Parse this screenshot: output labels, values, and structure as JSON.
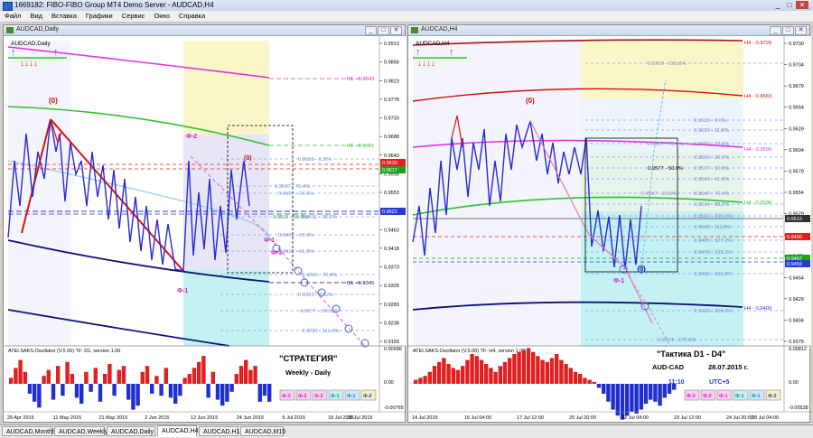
{
  "app": {
    "title": "1669182: FIBO-FIBO Group MT4 Demo Server - AUDCAD,H4",
    "window_controls": [
      "_",
      "□",
      "✕"
    ]
  },
  "menu": [
    "Файл",
    "Вид",
    "Вставка",
    "Графики",
    "Сервис",
    "Окно",
    "Справка"
  ],
  "left_chart": {
    "window_title": "AUDCAD,Daily",
    "symbol_label": "AUDCAD,Daily",
    "price_scale": [
      "0.9913",
      "0.9868",
      "0.9823",
      "0.9778",
      "0.9733",
      "0.9688",
      "0.9643",
      "0.9598",
      "0.9553",
      "0.9508",
      "0.9463",
      "0.9418",
      "0.9373",
      "0.9328",
      "0.9283",
      "0.9238",
      "0.9193"
    ],
    "price_tags": [
      "0.9633",
      "0.9617",
      "0.9521"
    ],
    "level_labels": [
      "D1 - 0.9849",
      "D1 - 0.9681",
      "D1 - 0.9345",
      "0.9656 - 0.0%",
      "0.9597 - 76.4%",
      "0.9567 - 23.6%",
      "0.9511 - 50.0%",
      "0.9511 - 38.2%",
      "0.9466 - 50.0%",
      "0.9422 - 61.8%",
      "0.9366 - 76.4%",
      "0.9322 - 88.2%",
      "0.9277 - 100.0%",
      "0.9232 - 111.8%"
    ],
    "wave_labels": [
      "(0)",
      "Ф-2",
      "(0)",
      "Ф-1",
      "Ф-3",
      "Ф-1"
    ],
    "oscillator_title": "ATEI.SAKS.Oscillator (V.5.00) TF: D1, version 1.00",
    "oscillator_scale": [
      "0.00696",
      "0.00",
      "-0.00765"
    ],
    "overlay_title": "\"СТРАТЕГИЯ\"",
    "overlay_subtitle": "Weekly - Daily",
    "fib_buttons": [
      "Ф-3",
      "Ф-2",
      "Ф-2",
      "Ф-1",
      "Ф-1",
      "Ф-2"
    ],
    "dates": [
      "29 Apr 2015",
      "11 May 2015",
      "21 May 2015",
      "2 Jun 2015",
      "12 Jun 2015",
      "24 Jun 2015",
      "6 Jul 2015",
      "16 Jul 2015",
      "28 Jul 2015"
    ]
  },
  "right_chart": {
    "window_title": "AUDCAD,H4",
    "symbol_label": "AUDCAD,H4",
    "price_scale": [
      "0.9730",
      "0.9704",
      "0.9679",
      "0.9654",
      "0.9629",
      "0.9604",
      "0.9579",
      "0.9554",
      "0.9529",
      "0.9504",
      "0.9479",
      "0.9454",
      "0.9429",
      "0.9404",
      "0.9379"
    ],
    "price_tags": [
      "0.9513",
      "0.9490",
      "0.9467",
      "0.9459"
    ],
    "level_labels": [
      "H4 - 0.9726",
      "H4 - 0.9663",
      "H4 - 0.9599",
      "H4 - 0.9536",
      "H4 - 0.9409",
      "0.9703 - 190.0%",
      "0.9633 - 0.0%",
      "0.9623 - 11.8%",
      "0.9607 - 76.4%",
      "0.9602 - 23.6%",
      "0.9590 - 38.2%",
      "0.9577 - 50.0%",
      "0.9577 - 50.0%",
      "0.9564 - 61.8%",
      "0.9547 - 23.6%",
      "0.9547 - 76.4%",
      "0.9534 - 88.2%",
      "0.9521 - 100.0%",
      "0.9508 - 111.8%",
      "0.9485 - 127.2%",
      "0.9478 - 138.2%",
      "0.9432 - 161.8%",
      "0.9409 - 200.0%",
      "0.9374 - 270.0%"
    ],
    "wave_labels": [
      "(0)",
      "Ф-1",
      "(0)"
    ],
    "oscillator_title": "ATEI.SAKS.Oscillator (V.5.00) TF: H4, version 1.00",
    "oscillator_scale": [
      "0.00812",
      "0.00",
      "-0.00538"
    ],
    "overlay_title": "\"Тактика  D1 - D4\"",
    "overlay_pair": "AUD-CAD",
    "overlay_date": "28.07.2015 г.",
    "overlay_time": "11:10",
    "overlay_tz": "UTC+5",
    "fib_buttons": [
      "Ф-3",
      "Ф-2",
      "Ф-1",
      "Ф-1",
      "Ф-1",
      "Ф-2"
    ],
    "dates": [
      "14 Jul 2015",
      "16 Jul 04:00",
      "17 Jul 12:00",
      "20 Jul 20:00",
      "22 Jul 04:00",
      "23 Jul 12:00",
      "24 Jul 20:00",
      "28 Jul 04:00"
    ]
  },
  "tabs": [
    "AUDCAD,Monthly",
    "AUDCAD,Weekly",
    "AUDCAD,Daily",
    "AUDCAD,H4",
    "AUDCAD,H1",
    "AUDCAD,M15"
  ],
  "active_tab": "AUDCAD,H4",
  "colors": {
    "bull": "#1d2ad6",
    "bear": "#e01010",
    "magenta": "#e020e0",
    "green": "#30c030",
    "navy": "#10107a",
    "zone_yellow": "#fbf6c8",
    "zone_cyan": "#bff2f2",
    "zone_lavender": "#e8e8f8",
    "tag_red": "#e02020",
    "tag_green": "#20a020",
    "tag_blue": "#2a3ad8"
  }
}
